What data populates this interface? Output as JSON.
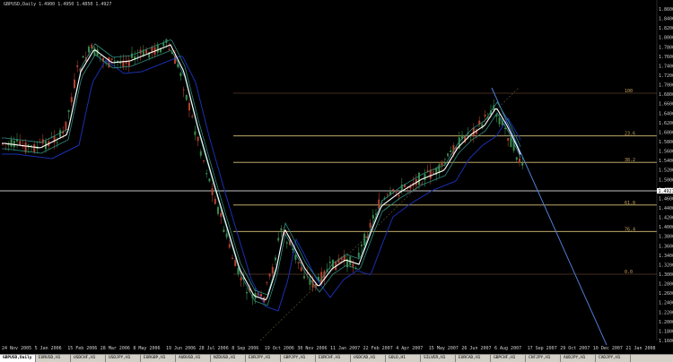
{
  "header": {
    "symbol_text": "GBPUSD,Daily 1.4900 1.4950 1.4850 1.4927"
  },
  "colors": {
    "background": "#000000",
    "candle_up": "#3a8a4a",
    "candle_down": "#b5412e",
    "ma_fast": "#ffffff",
    "ma_mid": "#2f8c80",
    "ma_slow": "#1a2fb0",
    "fib_line": "#d9c27a",
    "trend_line": "#4e7fd6"
  },
  "price_axis": {
    "labels": [
      "1.8600",
      "1.8400",
      "1.8200",
      "1.8000",
      "1.7800",
      "1.7600",
      "1.7400",
      "1.7200",
      "1.7000",
      "1.6800",
      "1.6600",
      "1.6400",
      "1.6200",
      "1.6000",
      "1.5800",
      "1.5600",
      "1.5400",
      "1.5200",
      "1.5000",
      "1.4800",
      "1.4600",
      "1.4400",
      "1.4200",
      "1.4000",
      "1.3800",
      "1.3600",
      "1.3400",
      "1.3200",
      "1.3000",
      "1.2800",
      "1.2600",
      "1.2400",
      "1.2200",
      "1.2000",
      "1.1800",
      "1.1600"
    ],
    "current_price": "1.4927"
  },
  "fib_levels": [
    {
      "label": "100",
      "fraction": 0.0
    },
    {
      "label": "23.6",
      "fraction": 0.236
    },
    {
      "label": "38.2",
      "fraction": 0.382
    },
    {
      "label": "61.8",
      "fraction": 0.618
    },
    {
      "label": "76.4",
      "fraction": 0.764
    },
    {
      "label": "0.0",
      "fraction": 1.0
    }
  ],
  "time_axis": {
    "labels": [
      "24 Nov 2005",
      "5 Jan 2006",
      "15 Feb 2006",
      "28 Mar 2006",
      "8 May 2006",
      "19 Jun 2006",
      "28 Jul 2006",
      "8 Sep 2006",
      "19 Oct 2006",
      "30 Nov 2006",
      "11 Jan 2007",
      "22 Feb 2007",
      "4 Apr 2007",
      "15 May 2007",
      "26 Jun 2007",
      "6 Aug 2007",
      "17 Sep 2007",
      "29 Oct 2007",
      "10 Dec 2007",
      "21 Jan 2008"
    ]
  },
  "tabs": [
    {
      "label": "GBPUSD,Daily",
      "active": true
    },
    {
      "label": "EURUSD,H1",
      "active": false
    },
    {
      "label": "USDCHF,H1",
      "active": false
    },
    {
      "label": "USDJPY,H1",
      "active": false
    },
    {
      "label": "EURGBP,H1",
      "active": false
    },
    {
      "label": "AUDUSD,H1",
      "active": false
    },
    {
      "label": "NZDUSD,H1",
      "active": false
    },
    {
      "label": "EURJPY,H1",
      "active": false
    },
    {
      "label": "GBPJPY,H1",
      "active": false
    },
    {
      "label": "EURCHF,H1",
      "active": false
    },
    {
      "label": "USDCAD,H1",
      "active": false
    },
    {
      "label": "GOLD,H1",
      "active": false
    },
    {
      "label": "SILVER,H1",
      "active": false
    },
    {
      "label": "EURCAD,H1",
      "active": false
    },
    {
      "label": "GBPCHF,H1",
      "active": false
    },
    {
      "label": "CHFJPY,H1",
      "active": false
    },
    {
      "label": "AUDJPY,H1",
      "active": false
    },
    {
      "label": "CADJPY,H1",
      "active": false
    }
  ]
}
